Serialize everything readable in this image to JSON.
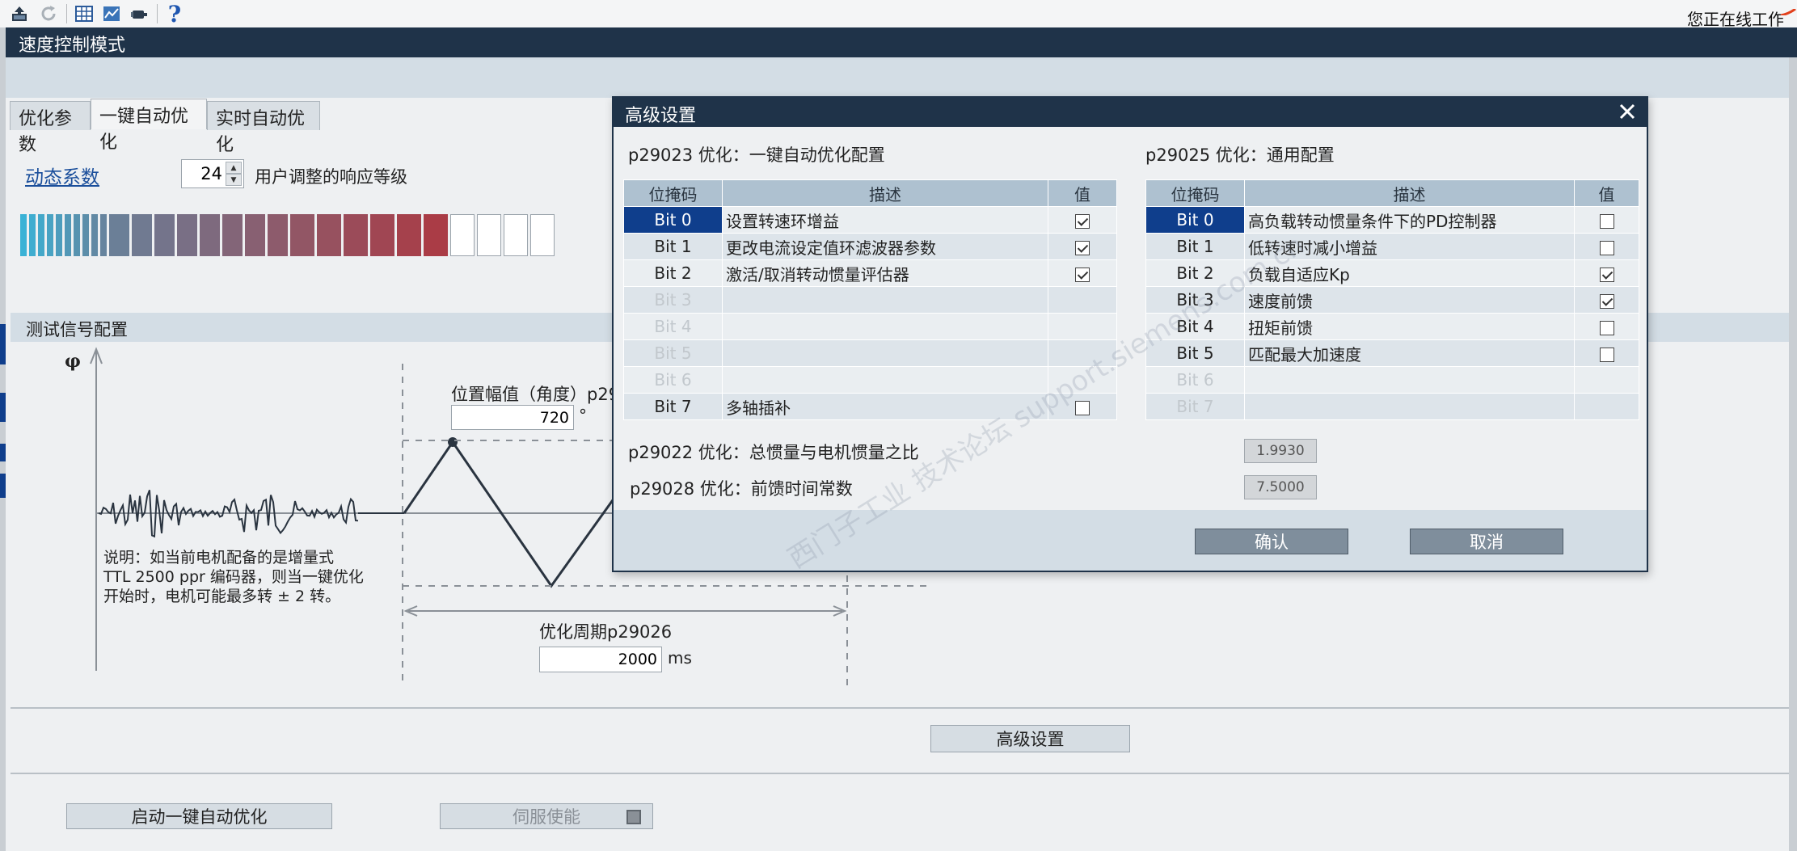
{
  "toolbar": {
    "icons": [
      "upload-icon",
      "refresh-icon",
      "table-icon",
      "chart-icon",
      "motor-icon",
      "help-icon"
    ],
    "help_glyph": "?",
    "online_status": "您正在线工作"
  },
  "window": {
    "title": "速度控制模式"
  },
  "tabs": [
    {
      "label": "优化参数",
      "active": false
    },
    {
      "label": "一键自动优化",
      "active": true
    },
    {
      "label": "实时自动优化",
      "active": false
    }
  ],
  "dynamic": {
    "link_label": "动态系数",
    "value": "24",
    "description": "用户调整的响应等级"
  },
  "test_signal": {
    "section_title": "测试信号配置",
    "axis_label": "φ",
    "note_lines": [
      "说明：如当前电机配备的是增量式",
      "TTL 2500 ppr 编码器，则当一键优化",
      "开始时，电机可能最多转 ± 2 转。"
    ],
    "amplitude_label": "位置幅值（角度）p29",
    "amplitude_value": "720",
    "amplitude_unit": "°",
    "period_label": "优化周期p29026",
    "period_value": "2000",
    "period_unit": "ms"
  },
  "buttons": {
    "advanced": "高级设置",
    "start": "启动一键自动优化",
    "servo": "伺服使能"
  },
  "dialog": {
    "title": "高级设置",
    "left_title": "p29023  优化：一键自动优化配置",
    "right_title": "p29025  优化：通用配置",
    "columns": {
      "code": "位掩码",
      "desc": "描述",
      "val": "值"
    },
    "left_rows": [
      {
        "code": "Bit 0",
        "desc": "设置转速环增益",
        "checked": true,
        "enabled": true,
        "selected": true
      },
      {
        "code": "Bit 1",
        "desc": "更改电流设定值环滤波器参数",
        "checked": true,
        "enabled": true
      },
      {
        "code": "Bit 2",
        "desc": "激活/取消转动惯量评估器",
        "checked": true,
        "enabled": true
      },
      {
        "code": "Bit 3",
        "desc": "",
        "enabled": false
      },
      {
        "code": "Bit 4",
        "desc": "",
        "enabled": false
      },
      {
        "code": "Bit 5",
        "desc": "",
        "enabled": false
      },
      {
        "code": "Bit 6",
        "desc": "",
        "enabled": false
      },
      {
        "code": "Bit 7",
        "desc": "多轴插补",
        "checked": false,
        "enabled": true
      }
    ],
    "right_rows": [
      {
        "code": "Bit 0",
        "desc": "高负载转动惯量条件下的PD控制器",
        "checked": false,
        "enabled": true,
        "selected": true
      },
      {
        "code": "Bit 1",
        "desc": "低转速时减小增益",
        "checked": false,
        "enabled": true
      },
      {
        "code": "Bit 2",
        "desc": "负载自适应Kp",
        "checked": true,
        "enabled": true
      },
      {
        "code": "Bit 3",
        "desc": "速度前馈",
        "checked": true,
        "enabled": true
      },
      {
        "code": "Bit 4",
        "desc": "扭矩前馈",
        "checked": false,
        "enabled": true
      },
      {
        "code": "Bit 5",
        "desc": "匹配最大加速度",
        "checked": false,
        "enabled": true
      },
      {
        "code": "Bit 6",
        "desc": "",
        "enabled": false
      },
      {
        "code": "Bit 7",
        "desc": "",
        "enabled": false
      }
    ],
    "p29022_label": "p29022 优化：总惯量与电机惯量之比",
    "p29022_value": "1.9930",
    "p29028_label": "p29028 优化：前馈时间常数",
    "p29028_value": "7.5000",
    "ok": "确认",
    "cancel": "取消",
    "watermark": "西门子工业  技术论坛  support.siemens.com.cn"
  },
  "colors": {
    "title_bar": "#1f3349",
    "selection": "#0f3e8c",
    "header_band": "#d3dde5"
  }
}
